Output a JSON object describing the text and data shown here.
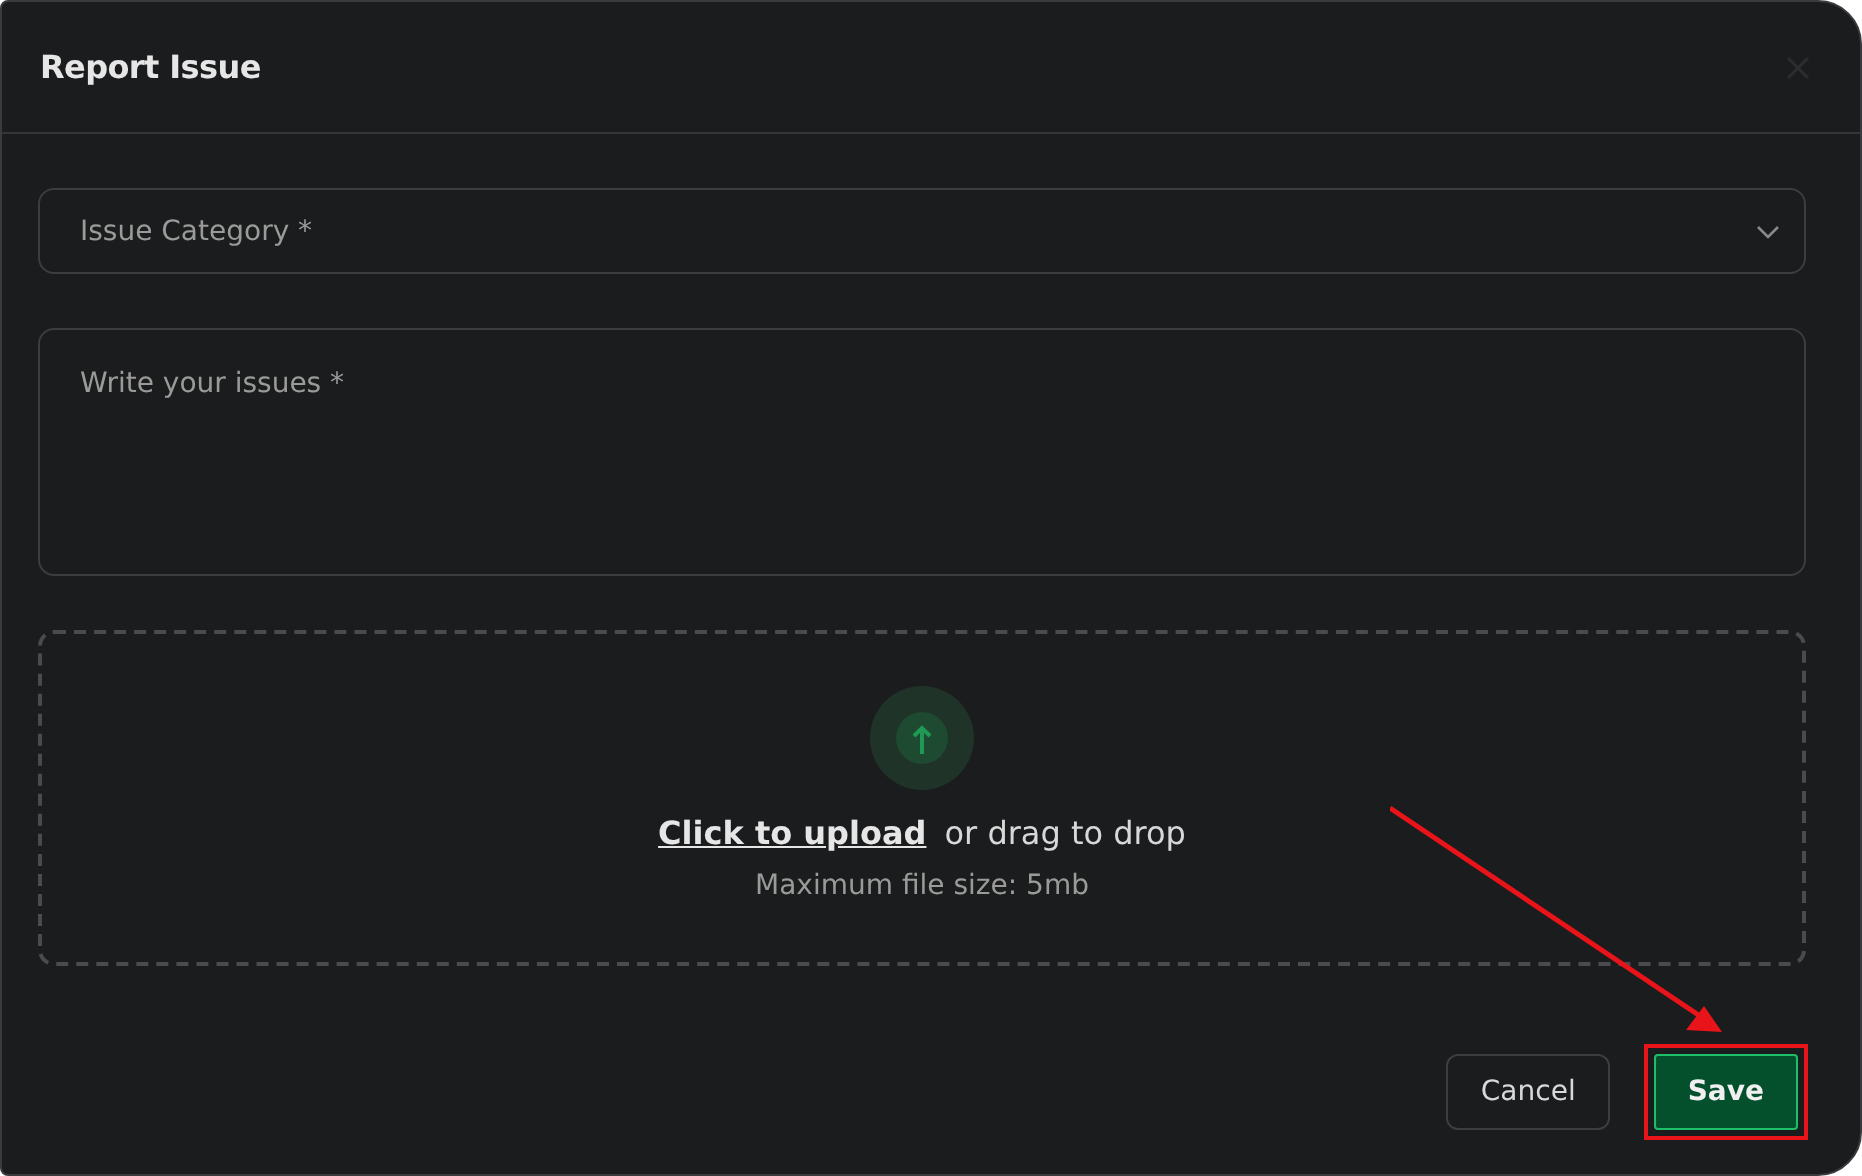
{
  "dialog": {
    "title": "Report Issue"
  },
  "category": {
    "placeholder": "Issue Category *"
  },
  "issue": {
    "placeholder": "Write your issues *"
  },
  "upload": {
    "link": "Click to upload",
    "text": "or drag to drop",
    "hint": "Maximum file size: 5mb"
  },
  "buttons": [
    {
      "label": "Cancel",
      "kind": "secondary",
      "highlighted": false
    },
    {
      "label": "Save",
      "kind": "primary",
      "highlighted": true
    }
  ]
}
